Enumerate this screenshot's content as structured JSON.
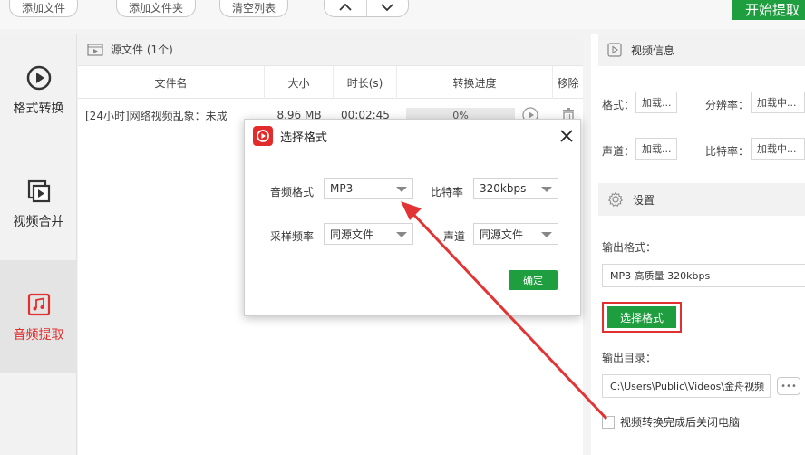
{
  "toolbar": {
    "add_file": "添加文件",
    "add_folder": "添加文件夹",
    "clear_list": "清空列表",
    "start_extract": "开始提取"
  },
  "nav": {
    "items": [
      {
        "label": "格式转换",
        "icon": "play-circle-icon"
      },
      {
        "label": "视频合并",
        "icon": "video-merge-icon"
      },
      {
        "label": "音频提取",
        "icon": "music-note-icon"
      }
    ],
    "active_index": 2
  },
  "file_list": {
    "header": "源文件 (1个)",
    "columns": [
      "文件名",
      "大小",
      "时长(s)",
      "转换进度",
      "移除"
    ],
    "rows": [
      {
        "name": "[24小时]网络视频乱象：未成",
        "size": "8.96 MB",
        "duration": "00:02:45",
        "progress": "0%",
        "progress_fraction": 0.0
      }
    ]
  },
  "video_info": {
    "title": "视频信息",
    "format_label": "格式：",
    "format_value": "加载...",
    "resolution_label": "分辨率：",
    "resolution_value": "加载中...",
    "channel_label": "声道：",
    "channel_value": "加载...",
    "bitrate_label": "比特率：",
    "bitrate_value": "加载中..."
  },
  "settings": {
    "title": "设置",
    "output_format_label": "输出格式：",
    "output_format_value": "MP3 高质量 320kbps",
    "select_format_button": "选择格式",
    "output_dir_label": "输出目录：",
    "output_dir_value": "C:\\Users\\Public\\Videos\\金舟视频",
    "browse_button": "•••",
    "shutdown_checkbox_label": "视频转换完成后关闭电脑",
    "shutdown_checked": false
  },
  "dialog": {
    "title": "选择格式",
    "audio_format_label": "音频格式",
    "audio_format_value": "MP3",
    "bitrate_label": "比特率",
    "bitrate_value": "320kbps",
    "sample_rate_label": "采样频率",
    "sample_rate_value": "同源文件",
    "channel_label": "声道",
    "channel_value": "同源文件",
    "ok_button": "确定"
  },
  "colors": {
    "accent_green": "#1f9e3f",
    "highlight_red": "#e03030",
    "logo_red": "#e32b2b"
  }
}
